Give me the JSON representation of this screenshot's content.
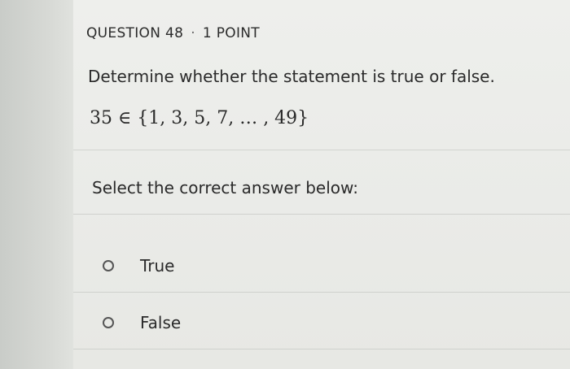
{
  "question": {
    "number_label": "QUESTION 48",
    "separator": "·",
    "points_label": "1 POINT",
    "prompt": "Determine whether the statement is true or false.",
    "statement": "35 ∈ {1, 3, 5, 7, … , 49}"
  },
  "answer_section": {
    "instruction": "Select the correct answer below:",
    "options": [
      {
        "label": "True",
        "selected": false
      },
      {
        "label": "False",
        "selected": false
      }
    ]
  }
}
